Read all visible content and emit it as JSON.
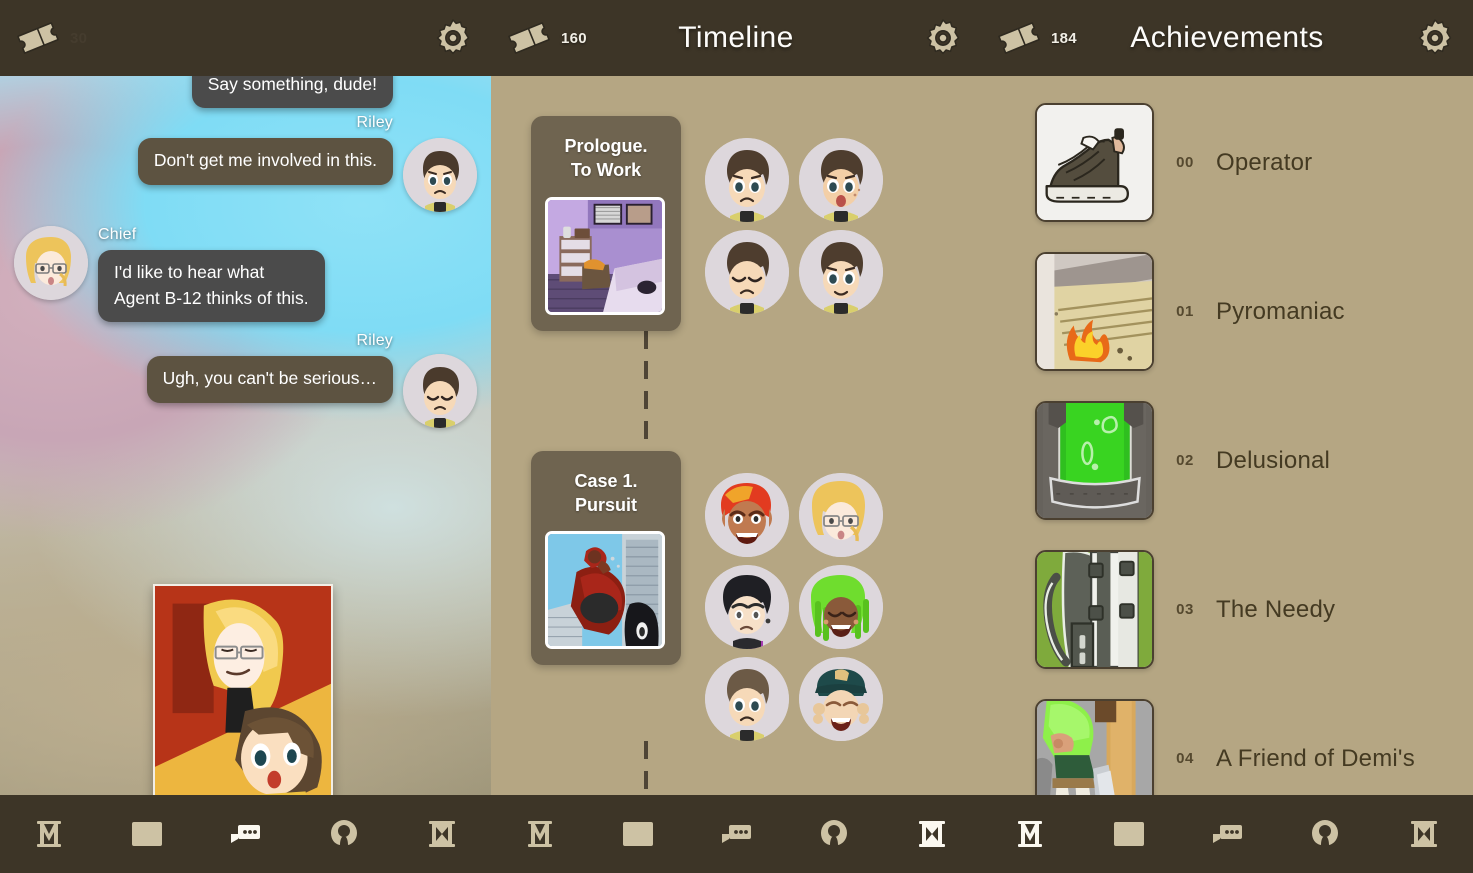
{
  "app": {
    "accent_bar": "#3d3527",
    "panel_bg": "#b5a683",
    "card_bg": "#6f6450"
  },
  "panels": [
    {
      "id": "chat",
      "topbar": {
        "ticket_icon": "ticket-icon",
        "ticket_count": "30",
        "title": "",
        "gear_icon": "gear-icon"
      },
      "chat": {
        "messages": [
          {
            "speaker": "",
            "side": "right",
            "style": "dark",
            "text": "Say something, dude!"
          },
          {
            "speaker": "Riley",
            "side": "right",
            "style": "brown",
            "text": "Don't get me involved in this.",
            "avatar": "riley-sad-avatar"
          },
          {
            "speaker": "Chief",
            "side": "left",
            "style": "dark",
            "text": "I'd like to hear what\nAgent B-12 thinks of this.",
            "avatar": "chief-avatar"
          },
          {
            "speaker": "Riley",
            "side": "right",
            "style": "brown",
            "text": "Ugh, you can't be serious…",
            "avatar": "riley-annoyed-avatar"
          }
        ],
        "comic_panel": "comic-panel-three-characters"
      },
      "nav": [
        {
          "icon": "manga-m-icon",
          "active": false
        },
        {
          "icon": "gallery-image-icon",
          "active": false
        },
        {
          "icon": "chat-bubble-icon",
          "active": true
        },
        {
          "icon": "profile-person-icon",
          "active": false
        },
        {
          "icon": "hourglass-timeline-icon",
          "active": false
        }
      ]
    },
    {
      "id": "timeline",
      "topbar": {
        "ticket_icon": "ticket-icon",
        "ticket_count": "160",
        "title": "Timeline",
        "gear_icon": "gear-icon"
      },
      "episodes": [
        {
          "title": "Prologue.\nTo Work",
          "thumb": "bedroom-scene-thumb",
          "characters": [
            "riley-worried-face",
            "riley-shocked-face",
            "riley-neutral-face",
            "riley-smile-face"
          ]
        },
        {
          "title": "Case 1.\nPursuit",
          "thumb": "motorcycle-chase-thumb",
          "characters": [
            "red-hair-angry-face",
            "chief-blonde-face",
            "black-hair-face",
            "green-dreads-face",
            "riley-face",
            "cap-laughing-face"
          ]
        }
      ],
      "nav": [
        {
          "icon": "manga-m-icon",
          "active": false
        },
        {
          "icon": "gallery-image-icon",
          "active": false
        },
        {
          "icon": "chat-bubble-icon",
          "active": false
        },
        {
          "icon": "profile-person-icon",
          "active": false
        },
        {
          "icon": "hourglass-timeline-icon",
          "active": true
        }
      ]
    },
    {
      "id": "achievements",
      "topbar": {
        "ticket_icon": "ticket-icon",
        "ticket_count": "184",
        "title": "Achievements",
        "gear_icon": "gear-icon"
      },
      "achievements": [
        {
          "num": "00",
          "name": "Operator",
          "thumb": "sneaker-shoe-thumb"
        },
        {
          "num": "01",
          "name": "Pyromaniac",
          "thumb": "fire-flames-thumb"
        },
        {
          "num": "02",
          "name": "Delusional",
          "thumb": "green-liquid-jar-thumb"
        },
        {
          "num": "03",
          "name": "The Needy",
          "thumb": "backpack-thumb"
        },
        {
          "num": "04",
          "name": "A Friend of Demi's",
          "thumb": "green-outfit-character-thumb"
        }
      ],
      "nav": [
        {
          "icon": "manga-m-icon",
          "active": true
        },
        {
          "icon": "gallery-image-icon",
          "active": false
        },
        {
          "icon": "chat-bubble-icon",
          "active": false
        },
        {
          "icon": "profile-person-icon",
          "active": false
        },
        {
          "icon": "hourglass-timeline-icon",
          "active": false
        }
      ]
    }
  ]
}
